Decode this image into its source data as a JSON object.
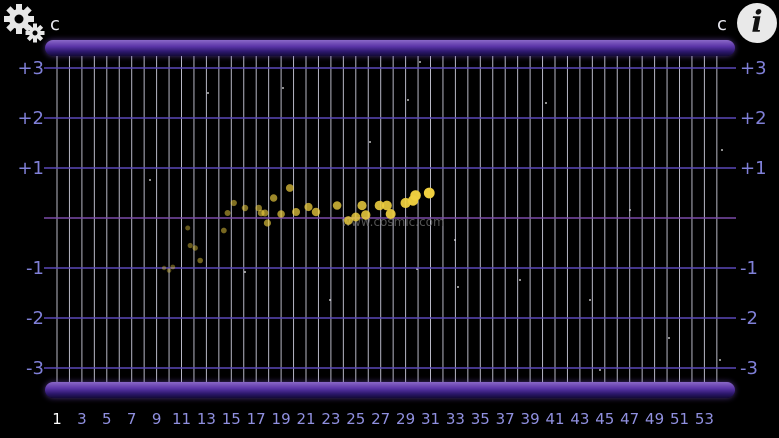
{
  "header": {
    "left_letter": "c",
    "right_letter": "c",
    "settings_icon": "gear-icon",
    "info_icon": "info-icon",
    "info_glyph": "i"
  },
  "y_axis": {
    "labels": [
      {
        "text": "+3",
        "value": 3
      },
      {
        "text": "+2",
        "value": 2
      },
      {
        "text": "+1",
        "value": 1
      },
      {
        "text": "-1",
        "value": -1
      },
      {
        "text": "-2",
        "value": -2
      },
      {
        "text": "-3",
        "value": -3
      }
    ]
  },
  "x_axis": {
    "labels": [
      "1",
      "3",
      "5",
      "7",
      "9",
      "11",
      "13",
      "15",
      "17",
      "19",
      "21",
      "23",
      "25",
      "27",
      "29",
      "31",
      "33",
      "35",
      "37",
      "39",
      "41",
      "43",
      "45",
      "47",
      "49",
      "51",
      "53"
    ]
  },
  "watermark": "www.cosmic.com",
  "colors": {
    "grid_vertical": "#d8d8e8",
    "grid_horizontal": "#5a48b8",
    "zero_line": "#7a4aa8",
    "point_color": "#f0d040",
    "axis_label": "#8080d8"
  },
  "chart_data": {
    "type": "scatter",
    "title": "",
    "xlabel": "",
    "ylabel": "",
    "xlim": [
      0,
      55
    ],
    "ylim": [
      -3.5,
      3.5
    ],
    "grid": true,
    "points": [
      {
        "x": 9.6,
        "y": -1.0
      },
      {
        "x": 10.0,
        "y": -1.05
      },
      {
        "x": 10.3,
        "y": -0.98
      },
      {
        "x": 11.5,
        "y": -0.2
      },
      {
        "x": 11.7,
        "y": -0.55
      },
      {
        "x": 12.1,
        "y": -0.6
      },
      {
        "x": 12.5,
        "y": -0.85
      },
      {
        "x": 14.4,
        "y": -0.25
      },
      {
        "x": 14.7,
        "y": 0.1
      },
      {
        "x": 15.2,
        "y": 0.3
      },
      {
        "x": 16.1,
        "y": 0.2
      },
      {
        "x": 17.2,
        "y": 0.2
      },
      {
        "x": 17.4,
        "y": 0.1
      },
      {
        "x": 17.7,
        "y": 0.1
      },
      {
        "x": 17.9,
        "y": -0.1
      },
      {
        "x": 18.4,
        "y": 0.4
      },
      {
        "x": 19.0,
        "y": 0.08
      },
      {
        "x": 19.7,
        "y": 0.6
      },
      {
        "x": 20.2,
        "y": 0.12
      },
      {
        "x": 21.2,
        "y": 0.22
      },
      {
        "x": 21.8,
        "y": 0.12
      },
      {
        "x": 23.5,
        "y": 0.25
      },
      {
        "x": 24.4,
        "y": -0.05
      },
      {
        "x": 25.0,
        "y": 0.02
      },
      {
        "x": 25.5,
        "y": 0.25
      },
      {
        "x": 25.8,
        "y": 0.06
      },
      {
        "x": 26.9,
        "y": 0.25
      },
      {
        "x": 27.5,
        "y": 0.25
      },
      {
        "x": 27.8,
        "y": 0.08
      },
      {
        "x": 29.0,
        "y": 0.3
      },
      {
        "x": 29.6,
        "y": 0.35
      },
      {
        "x": 29.8,
        "y": 0.45
      },
      {
        "x": 30.9,
        "y": 0.5
      }
    ]
  }
}
